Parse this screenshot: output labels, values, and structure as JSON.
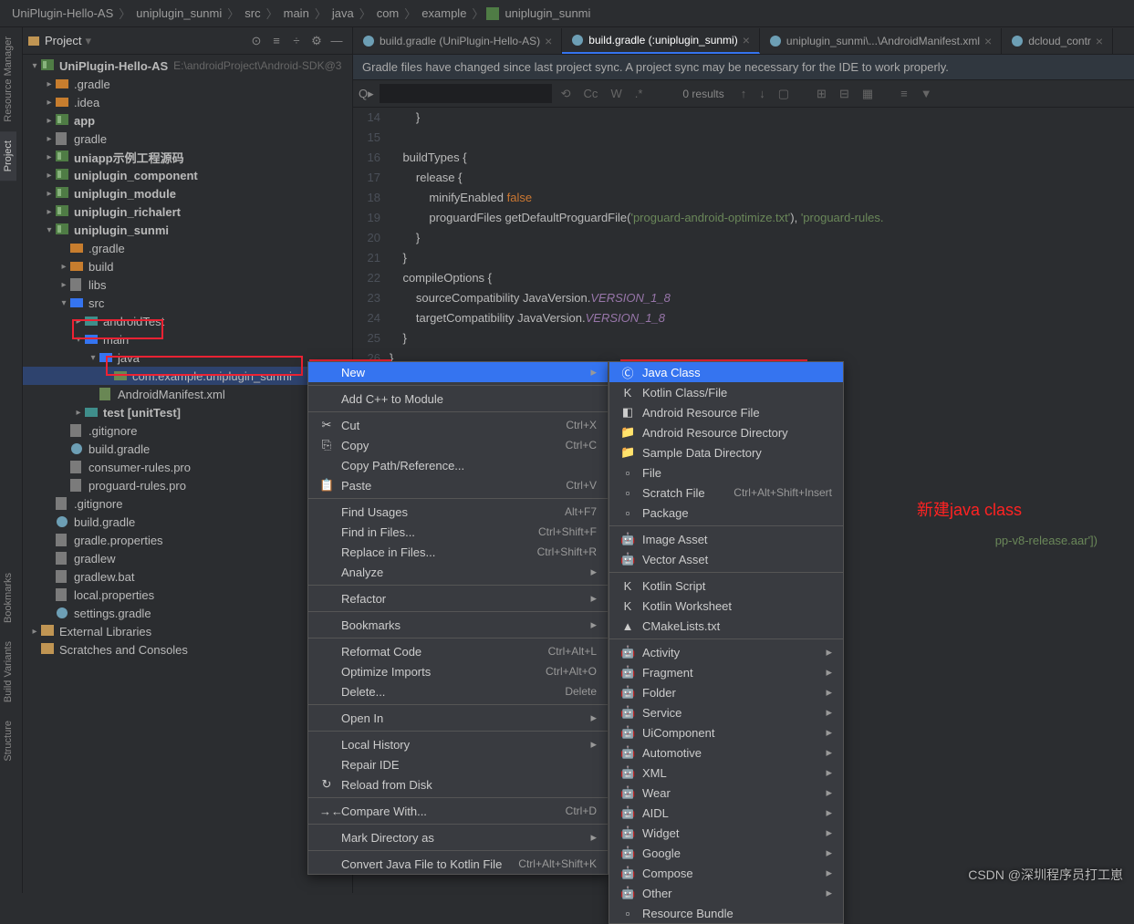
{
  "breadcrumb": [
    "UniPlugin-Hello-AS",
    "uniplugin_sunmi",
    "src",
    "main",
    "java",
    "com",
    "example",
    "uniplugin_sunmi"
  ],
  "sidebar": {
    "title": "Project",
    "root": {
      "label": "UniPlugin-Hello-AS",
      "path": "E:\\androidProject\\Android-SDK@3"
    },
    "items": [
      {
        "label": ".gradle",
        "depth": 1,
        "type": "folder-orange",
        "closed": true
      },
      {
        "label": ".idea",
        "depth": 1,
        "type": "folder-orange",
        "closed": true
      },
      {
        "label": "app",
        "depth": 1,
        "type": "module",
        "closed": true,
        "bold": true
      },
      {
        "label": "gradle",
        "depth": 1,
        "type": "folder",
        "closed": true
      },
      {
        "label": "uniapp示例工程源码",
        "depth": 1,
        "type": "module",
        "closed": true,
        "bold": true
      },
      {
        "label": "uniplugin_component",
        "depth": 1,
        "type": "module",
        "closed": true,
        "bold": true
      },
      {
        "label": "uniplugin_module",
        "depth": 1,
        "type": "module",
        "closed": true,
        "bold": true
      },
      {
        "label": "uniplugin_richalert",
        "depth": 1,
        "type": "module",
        "closed": true,
        "bold": true
      },
      {
        "label": "uniplugin_sunmi",
        "depth": 1,
        "type": "module",
        "open": true,
        "bold": true
      },
      {
        "label": ".gradle",
        "depth": 2,
        "type": "folder-orange"
      },
      {
        "label": "build",
        "depth": 2,
        "type": "folder-orange",
        "closed": true
      },
      {
        "label": "libs",
        "depth": 2,
        "type": "folder",
        "closed": true
      },
      {
        "label": "src",
        "depth": 2,
        "type": "folder-blue",
        "open": true
      },
      {
        "label": "androidTest",
        "depth": 3,
        "type": "folder-teal",
        "closed": true
      },
      {
        "label": "main",
        "depth": 3,
        "type": "folder-blue",
        "open": true,
        "hl": true
      },
      {
        "label": "java",
        "depth": 4,
        "type": "folder-blue",
        "open": true
      },
      {
        "label": "com.example.uniplugin_sunmi",
        "depth": 5,
        "type": "package",
        "sel": true,
        "hl": true
      },
      {
        "label": "AndroidManifest.xml",
        "depth": 4,
        "type": "xml"
      },
      {
        "label": "test [unitTest]",
        "depth": 3,
        "type": "folder-teal",
        "closed": true,
        "bold": true
      },
      {
        "label": ".gitignore",
        "depth": 2,
        "type": "file"
      },
      {
        "label": "build.gradle",
        "depth": 2,
        "type": "gradle"
      },
      {
        "label": "consumer-rules.pro",
        "depth": 2,
        "type": "file"
      },
      {
        "label": "proguard-rules.pro",
        "depth": 2,
        "type": "file"
      },
      {
        "label": ".gitignore",
        "depth": 1,
        "type": "file"
      },
      {
        "label": "build.gradle",
        "depth": 1,
        "type": "gradle"
      },
      {
        "label": "gradle.properties",
        "depth": 1,
        "type": "file"
      },
      {
        "label": "gradlew",
        "depth": 1,
        "type": "file"
      },
      {
        "label": "gradlew.bat",
        "depth": 1,
        "type": "file"
      },
      {
        "label": "local.properties",
        "depth": 1,
        "type": "file"
      },
      {
        "label": "settings.gradle",
        "depth": 1,
        "type": "gradle"
      }
    ],
    "extlib": "External Libraries",
    "scratch": "Scratches and Consoles"
  },
  "tabs": [
    {
      "label": "build.gradle (UniPlugin-Hello-AS)"
    },
    {
      "label": "build.gradle (:uniplugin_sunmi)",
      "active": true
    },
    {
      "label": "uniplugin_sunmi\\...\\AndroidManifest.xml"
    },
    {
      "label": "dcloud_contr"
    }
  ],
  "banner": "Gradle files have changed since last project sync. A project sync may be necessary for the IDE to work properly.",
  "find": {
    "results": "0 results",
    "cc": "Cc",
    "w": "W"
  },
  "code": {
    "start": 14,
    "lines": [
      "        }",
      "",
      "    buildTypes {",
      "        release {",
      "            minifyEnabled <kw>false</kw>",
      "            proguardFiles getDefaultProguardFile(<str>'proguard-android-optimize.txt'</str>), <str>'proguard-rules.</str>",
      "        }",
      "    }",
      "    compileOptions {",
      "        sourceCompatibility JavaVersion.<ital>VERSION_1_8</ital>",
      "        targetCompatibility JavaVersion.<ital>VERSION_1_8</ital>",
      "    }",
      "}"
    ],
    "hidden_line": "pp-v8-release.aar'])"
  },
  "ctx1": [
    {
      "label": "New",
      "hi": true,
      "sub": true,
      "hl": true
    },
    {
      "sep": true
    },
    {
      "label": "Add C++ to Module"
    },
    {
      "sep": true
    },
    {
      "label": "Cut",
      "sc": "Ctrl+X",
      "ico": "✂"
    },
    {
      "label": "Copy",
      "sc": "Ctrl+C",
      "ico": "⎘"
    },
    {
      "label": "Copy Path/Reference..."
    },
    {
      "label": "Paste",
      "sc": "Ctrl+V",
      "ico": "📋"
    },
    {
      "sep": true
    },
    {
      "label": "Find Usages",
      "sc": "Alt+F7"
    },
    {
      "label": "Find in Files...",
      "sc": "Ctrl+Shift+F"
    },
    {
      "label": "Replace in Files...",
      "sc": "Ctrl+Shift+R"
    },
    {
      "label": "Analyze",
      "sub": true
    },
    {
      "sep": true
    },
    {
      "label": "Refactor",
      "sub": true
    },
    {
      "sep": true
    },
    {
      "label": "Bookmarks",
      "sub": true
    },
    {
      "sep": true
    },
    {
      "label": "Reformat Code",
      "sc": "Ctrl+Alt+L"
    },
    {
      "label": "Optimize Imports",
      "sc": "Ctrl+Alt+O"
    },
    {
      "label": "Delete...",
      "sc": "Delete"
    },
    {
      "sep": true
    },
    {
      "label": "Open In",
      "sub": true
    },
    {
      "sep": true
    },
    {
      "label": "Local History",
      "sub": true
    },
    {
      "label": "Repair IDE"
    },
    {
      "label": "Reload from Disk",
      "ico": "↻"
    },
    {
      "sep": true
    },
    {
      "label": "Compare With...",
      "sc": "Ctrl+D",
      "ico": "→←"
    },
    {
      "sep": true
    },
    {
      "label": "Mark Directory as",
      "sub": true
    },
    {
      "sep": true
    },
    {
      "label": "Convert Java File to Kotlin File",
      "sc": "Ctrl+Alt+Shift+K"
    }
  ],
  "ctx2": [
    {
      "label": "Java Class",
      "hi": true,
      "ico": "Ⓒ",
      "hl": true
    },
    {
      "label": "Kotlin Class/File",
      "ico": "K"
    },
    {
      "label": "Android Resource File",
      "ico": "◧"
    },
    {
      "label": "Android Resource Directory",
      "ico": "📁"
    },
    {
      "label": "Sample Data Directory",
      "ico": "📁"
    },
    {
      "label": "File",
      "ico": "▫"
    },
    {
      "label": "Scratch File",
      "sc": "Ctrl+Alt+Shift+Insert",
      "ico": "▫"
    },
    {
      "label": "Package",
      "ico": "▫"
    },
    {
      "sep": true
    },
    {
      "label": "Image Asset",
      "ico": "🤖"
    },
    {
      "label": "Vector Asset",
      "ico": "🤖"
    },
    {
      "sep": true
    },
    {
      "label": "Kotlin Script",
      "ico": "K"
    },
    {
      "label": "Kotlin Worksheet",
      "ico": "K"
    },
    {
      "label": "CMakeLists.txt",
      "ico": "▲"
    },
    {
      "sep": true
    },
    {
      "label": "Activity",
      "sub": true,
      "ico": "🤖"
    },
    {
      "label": "Fragment",
      "sub": true,
      "ico": "🤖"
    },
    {
      "label": "Folder",
      "sub": true,
      "ico": "🤖"
    },
    {
      "label": "Service",
      "sub": true,
      "ico": "🤖"
    },
    {
      "label": "UiComponent",
      "sub": true,
      "ico": "🤖"
    },
    {
      "label": "Automotive",
      "sub": true,
      "ico": "🤖"
    },
    {
      "label": "XML",
      "sub": true,
      "ico": "🤖"
    },
    {
      "label": "Wear",
      "sub": true,
      "ico": "🤖"
    },
    {
      "label": "AIDL",
      "sub": true,
      "ico": "🤖"
    },
    {
      "label": "Widget",
      "sub": true,
      "ico": "🤖"
    },
    {
      "label": "Google",
      "sub": true,
      "ico": "🤖"
    },
    {
      "label": "Compose",
      "sub": true,
      "ico": "🤖"
    },
    {
      "label": "Other",
      "sub": true,
      "ico": "🤖"
    },
    {
      "label": "Resource Bundle",
      "ico": "▫"
    }
  ],
  "tools": {
    "rm": "Resource Manager",
    "pr": "Project",
    "bm": "Bookmarks",
    "bv": "Build Variants",
    "st": "Structure"
  },
  "annotation": "新建java class",
  "watermark": "CSDN @深圳程序员打工崽"
}
